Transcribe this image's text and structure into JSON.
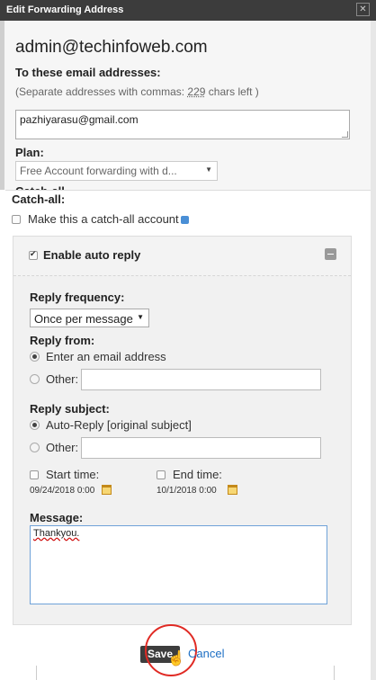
{
  "window": {
    "title": "Edit Forwarding Address",
    "close_icon": "close-icon"
  },
  "header": {
    "domain_email": "admin@techinfoweb.com",
    "to_label": "To these email addresses:",
    "hint_prefix": "(Separate addresses with commas: ",
    "hint_count": "229",
    "hint_suffix": " chars left )",
    "emails_value": "pazhiyarasu@gmail.com",
    "plan_label": "Plan:",
    "plan_value": "Free Account forwarding with d...",
    "catchall_peek": "Catch-all"
  },
  "catchall": {
    "label": "Catch-all:",
    "checkbox_label": "Make this a catch-all account",
    "checked": false
  },
  "autoreply": {
    "enable_label": "Enable auto reply",
    "enabled": true,
    "freq_label": "Reply frequency:",
    "freq_value": "Once per message",
    "from_label": "Reply from:",
    "from_option1": "Enter an email address",
    "from_option2": "Other:",
    "from_other_value": "",
    "subject_label": "Reply subject:",
    "subject_option1": "Auto-Reply [original subject]",
    "subject_option2": "Other:",
    "subject_other_value": "",
    "start_label": "Start time:",
    "start_value": "09/24/2018 0:00",
    "end_label": "End time:",
    "end_value": "10/1/2018 0:00",
    "message_label": "Message:",
    "message_value": "Thankyou."
  },
  "actions": {
    "save_label": "Save",
    "cancel_label": "Cancel"
  },
  "colors": {
    "link": "#1d6fc4",
    "highlight_circle": "#e02a24",
    "titlebar": "#3c3c3c"
  }
}
